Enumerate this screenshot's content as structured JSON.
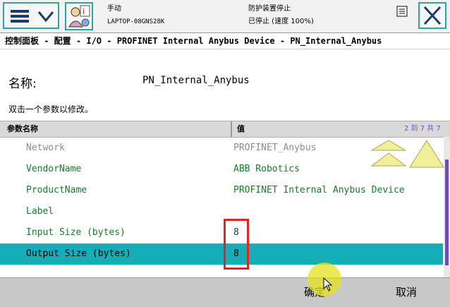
{
  "header": {
    "mode": "手动",
    "host": "LAPTOP-08GNS28K",
    "guard_status": "防护装置停止",
    "run_state": "已停止 (速度 100%)"
  },
  "breadcrumb": "控制面板 - 配置 - I/O - PROFINET Internal Anybus Device - PN_Internal_Anybus",
  "name_label": "名称:",
  "name_value": "PN_Internal_Anybus",
  "hint": "双击一个参数以修改。",
  "table": {
    "col_name": "参数名称",
    "col_value": "值",
    "page_info": "2 到 7 共 7",
    "rows": [
      {
        "name": "Network",
        "value": "PROFINET_Anybus"
      },
      {
        "name": "VendorName",
        "value": "ABB Robotics"
      },
      {
        "name": "ProductName",
        "value": "PROFINET Internal Anybus Device"
      },
      {
        "name": "Label",
        "value": ""
      },
      {
        "name": "Input Size (bytes)",
        "value": "8"
      },
      {
        "name": "Output Size (bytes)",
        "value": "8"
      }
    ]
  },
  "buttons": {
    "ok": "确定",
    "cancel": "取消"
  },
  "icons": {
    "menu": "hamburger-menu-icon",
    "status": "operator-status-icon",
    "flag": "event-flag-icon",
    "close": "close-icon",
    "scroll": "scroll-up-icon"
  },
  "colors": {
    "accent": "#15aeb8",
    "value_green": "#1b7a2a",
    "highlight_red": "#e8231e",
    "scroll_purple": "#7047c5"
  }
}
